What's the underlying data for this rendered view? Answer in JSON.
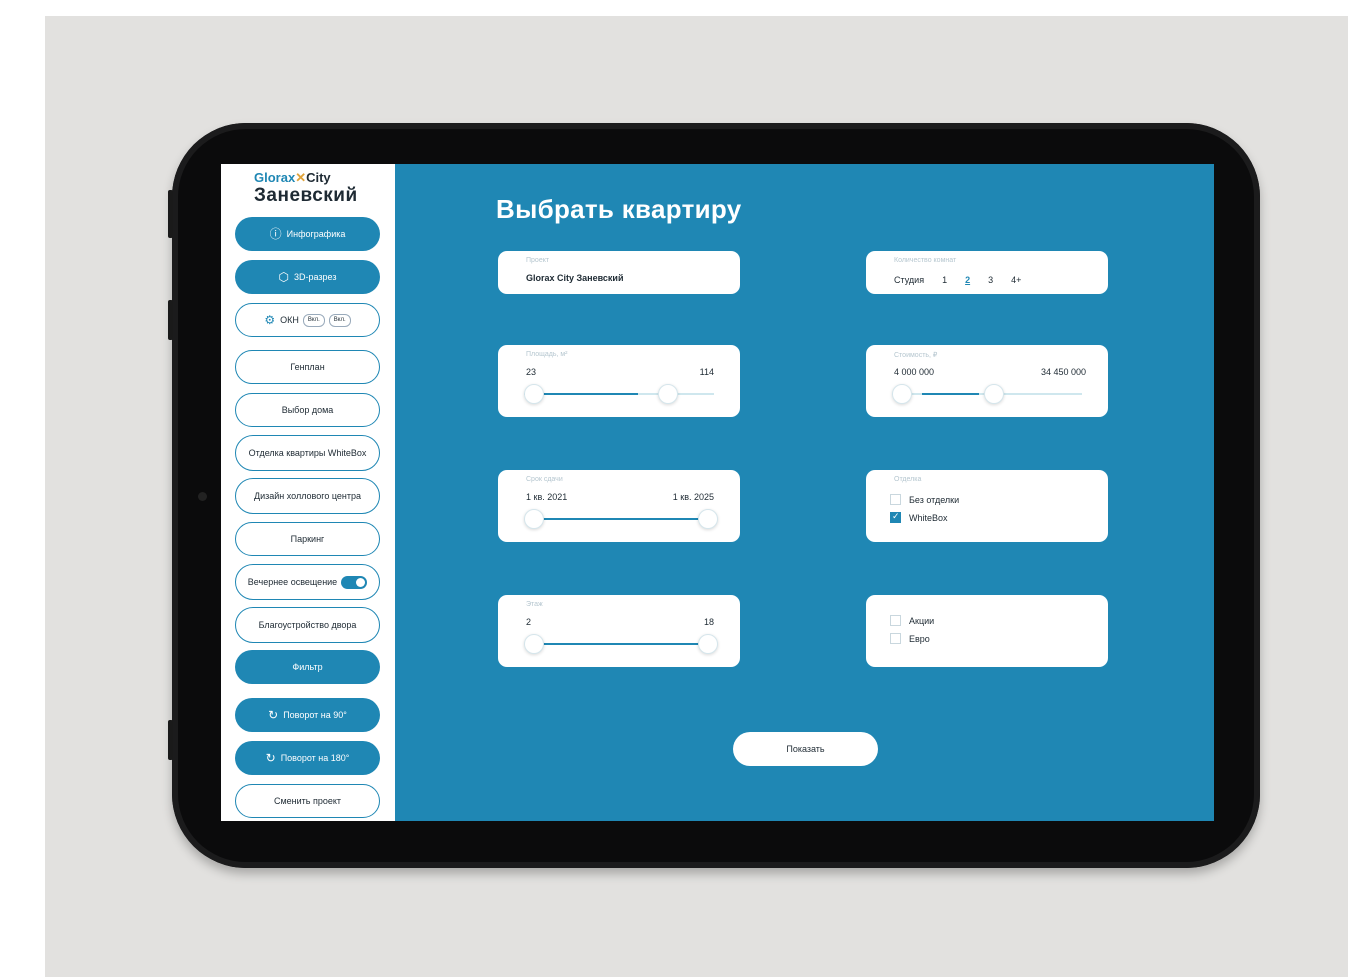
{
  "brand": {
    "line1_prefix": "Glorax",
    "line1_suffix": "City",
    "name": "Заневский"
  },
  "sidebar": {
    "items": [
      {
        "label": "Инфографика",
        "icon": "ⓘ",
        "style": "fill"
      },
      {
        "label": "3D-разрез",
        "icon": "⬡",
        "style": "fill"
      },
      {
        "label": "ОКН",
        "icon": "⚙",
        "style": "out",
        "extras": [
          "Вкл.",
          "Вкл."
        ]
      },
      {
        "label": "Генплан",
        "style": "out"
      },
      {
        "label": "Выбор дома",
        "style": "out"
      },
      {
        "label": "Отделка квартиры WhiteBox",
        "style": "out"
      },
      {
        "label": "Дизайн холлового центра",
        "style": "out"
      },
      {
        "label": "Паркинг",
        "style": "out"
      },
      {
        "label": "Вечернее освещение",
        "style": "out",
        "toggle": true
      },
      {
        "label": "Благоустройство двора",
        "style": "out"
      },
      {
        "label": "Фильтр",
        "style": "fill"
      },
      {
        "label": "Поворот на 90°",
        "icon": "↻",
        "style": "fill"
      },
      {
        "label": "Поворот на 180°",
        "icon": "↻",
        "style": "fill"
      },
      {
        "label": "Сменить проект",
        "style": "out"
      }
    ]
  },
  "main": {
    "title": "Выбрать квартиру",
    "project": {
      "label": "Проект",
      "value": "Glorax City Заневский"
    },
    "rooms": {
      "label": "Количество комнат",
      "options": [
        "Студия",
        "1",
        "2",
        "3",
        "4+"
      ],
      "selected": "2"
    },
    "area": {
      "label": "Площадь, м²",
      "min": "23",
      "max": "114",
      "fill_start": 0.0,
      "fill_end": 0.6
    },
    "price": {
      "label": "Стоимость, ₽",
      "min": "4 000 000",
      "max": "34 450 000",
      "fill_start": 0.0,
      "fill_end": 0.45
    },
    "deadline": {
      "label": "Срок сдачи",
      "min": "1 кв. 2021",
      "max": "1 кв. 2025",
      "fill_start": 0.0,
      "fill_end": 1.0
    },
    "finish": {
      "label": "Отделка",
      "options": [
        {
          "label": "Без отделки",
          "checked": false
        },
        {
          "label": "WhiteBox",
          "checked": true
        }
      ]
    },
    "floor": {
      "label": "Этаж",
      "min": "2",
      "max": "18",
      "fill_start": 0.0,
      "fill_end": 1.0
    },
    "extras": {
      "options": [
        {
          "label": "Акции",
          "checked": false
        },
        {
          "label": "Евро",
          "checked": false
        }
      ]
    },
    "show_button": "Показать"
  }
}
